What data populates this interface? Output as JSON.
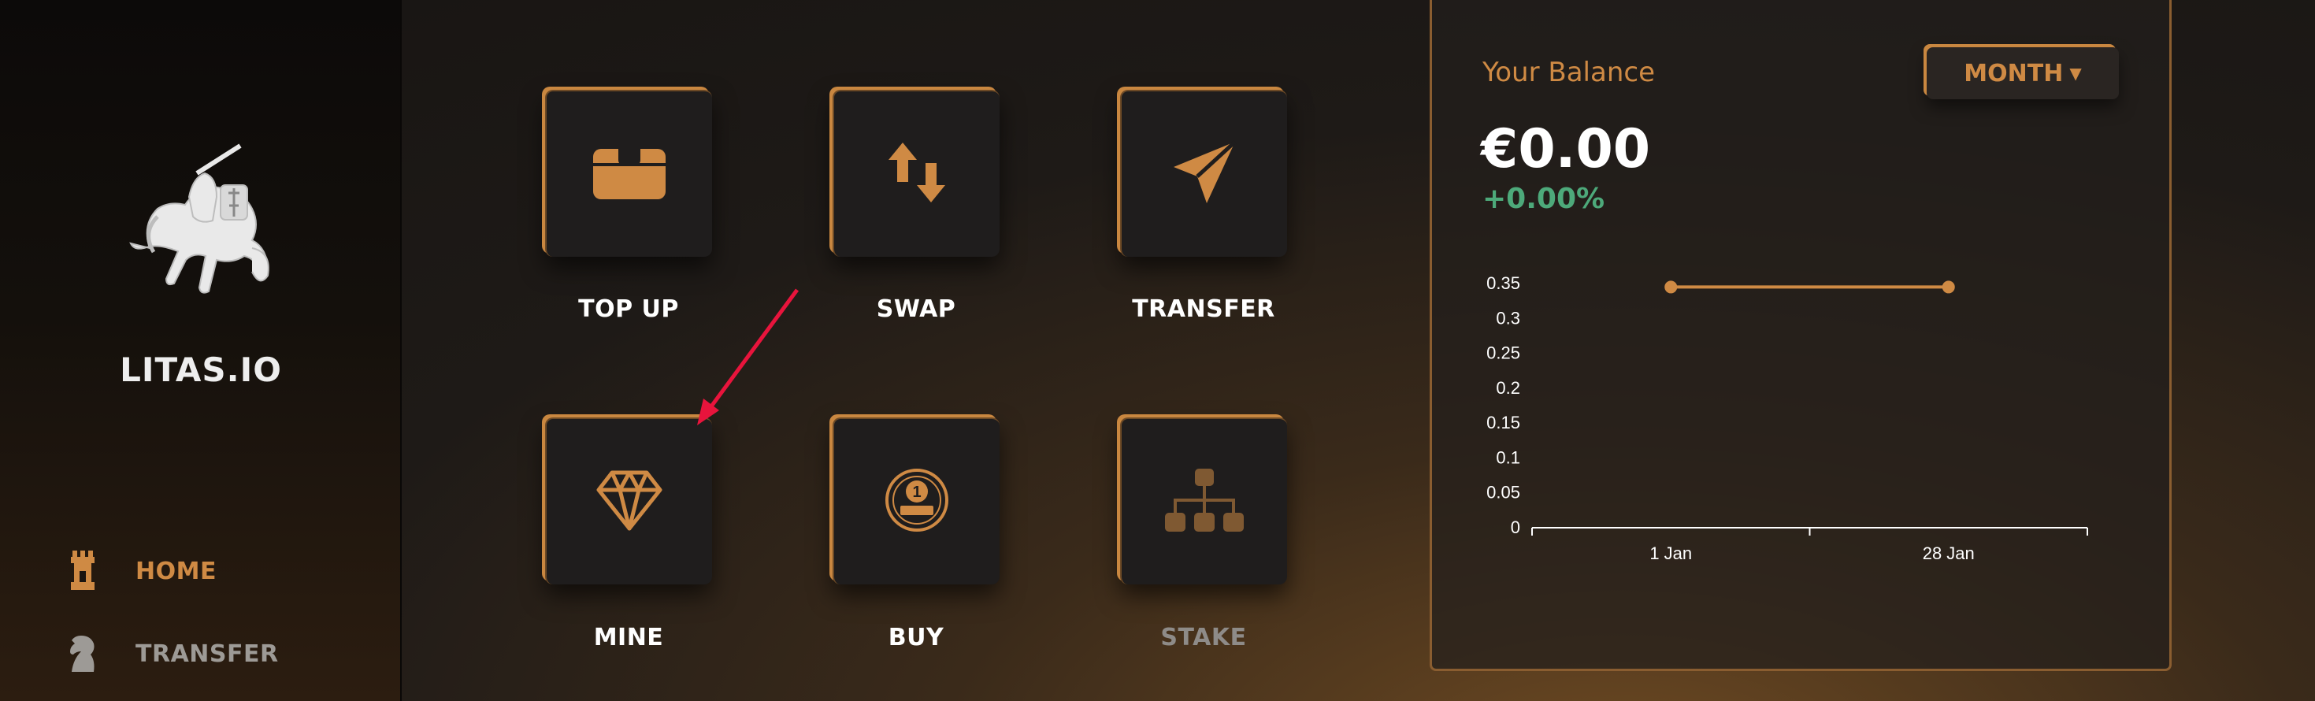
{
  "brand": {
    "name": "LITAS.IO",
    "logo": "vytis-knight-logo"
  },
  "sidebar": {
    "items": [
      {
        "label": "HOME",
        "icon": "castle-tower-icon",
        "active": true
      },
      {
        "label": "TRANSFER",
        "icon": "knight-chess-icon",
        "active": false
      }
    ]
  },
  "actions": [
    {
      "label": "TOP UP",
      "icon": "wallet-icon",
      "enabled": true
    },
    {
      "label": "SWAP",
      "icon": "swap-arrows-icon",
      "enabled": true
    },
    {
      "label": "TRANSFER",
      "icon": "paper-plane-icon",
      "enabled": true
    },
    {
      "label": "MINE",
      "icon": "diamond-icon",
      "enabled": true
    },
    {
      "label": "BUY",
      "icon": "litas-coin-icon",
      "enabled": true
    },
    {
      "label": "STAKE",
      "icon": "hierarchy-icon",
      "enabled": false
    }
  ],
  "balance": {
    "title": "Your Balance",
    "period": "MONTH",
    "amount": "€0.00",
    "change": "+0.00%"
  },
  "colors": {
    "accent": "#cf8a44",
    "positive": "#4da97a",
    "tile_bg": "#1f1d1d",
    "annotation_arrow": "#e8143c"
  },
  "chart_data": {
    "type": "line",
    "x": [
      "1 Jan",
      "28 Jan"
    ],
    "series": [
      {
        "values": [
          0.345,
          0.345
        ]
      }
    ],
    "yticks": [
      "0.35",
      "0.3",
      "0.25",
      "0.2",
      "0.15",
      "0.1",
      "0.05",
      "0"
    ],
    "ylim": [
      0,
      0.35
    ],
    "grid": false,
    "line_color": "#cf8a44"
  }
}
